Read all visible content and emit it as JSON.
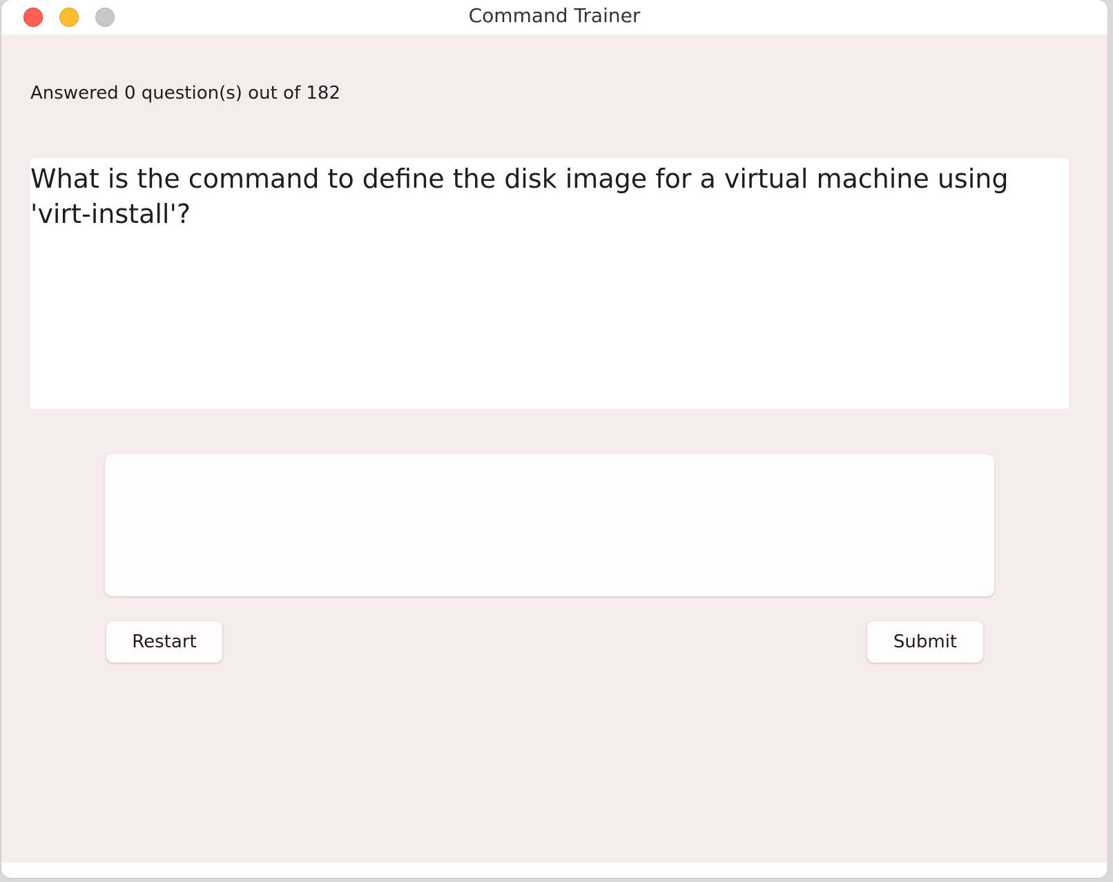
{
  "window": {
    "title": "Command Trainer",
    "controls": [
      "close-icon",
      "minimize-icon",
      "zoom-icon"
    ]
  },
  "progress": {
    "text": "Answered 0 question(s) out of 182",
    "answered": 0,
    "total": 182
  },
  "question": {
    "text": "What is the command to define the disk image for a virtual machine using 'virt-install'?"
  },
  "answer": {
    "value": "",
    "placeholder": ""
  },
  "buttons": {
    "restart_label": "Restart",
    "submit_label": "Submit"
  },
  "colors": {
    "background": "#f6ecee",
    "close": "#ff5f57",
    "minimize": "#febc2e",
    "zoom": "#c8c8c8"
  }
}
